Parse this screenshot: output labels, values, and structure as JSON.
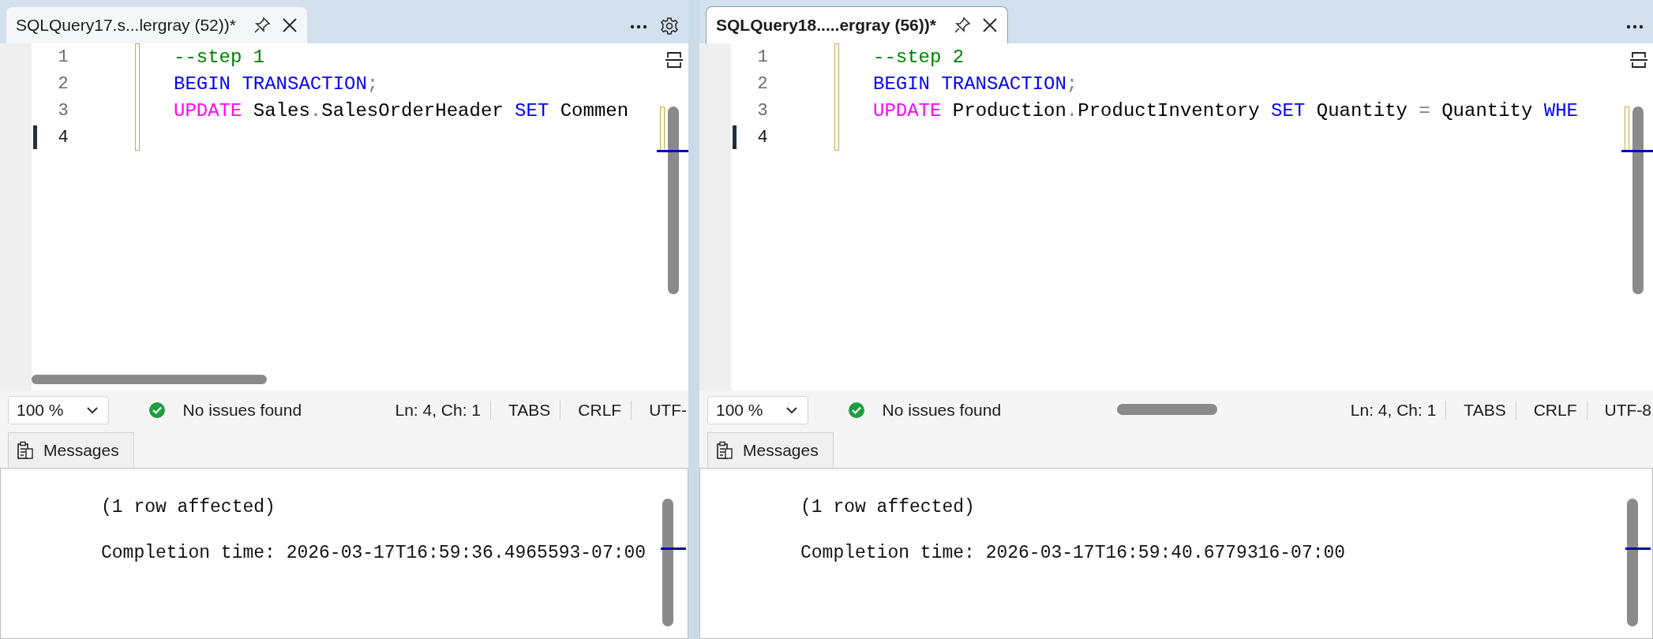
{
  "panes": [
    {
      "tab": {
        "title": "SQLQuery17.s...lergray (52))*",
        "selected": false
      },
      "has_settings": true,
      "lines": [
        {
          "number": "1",
          "current": false,
          "tokens": [
            {
              "text": "--step 1",
              "kind": "comment"
            }
          ]
        },
        {
          "number": "2",
          "current": false,
          "tokens": [
            {
              "text": "BEGIN TRANSACTION",
              "kind": "keyword"
            },
            {
              "text": ";",
              "kind": "punct"
            }
          ]
        },
        {
          "number": "3",
          "current": false,
          "tokens": [
            {
              "text": "UPDATE",
              "kind": "function"
            },
            {
              "text": " Sales",
              "kind": "plain"
            },
            {
              "text": ".",
              "kind": "punct"
            },
            {
              "text": "SalesOrderHeader ",
              "kind": "plain"
            },
            {
              "text": "SET",
              "kind": "keyword"
            },
            {
              "text": " Commen",
              "kind": "plain"
            }
          ]
        },
        {
          "number": "4",
          "current": true
        }
      ],
      "status": {
        "zoom": "100 %",
        "issues": "No issues found",
        "position": "Ln: 4, Ch: 1",
        "indent": "TABS",
        "line_ending": "CRLF",
        "encoding": "UTF-"
      },
      "messages_tab": "Messages",
      "messages": [
        "(1 row affected)",
        "Completion time: 2026-03-17T16:59:36.4965593-07:00"
      ]
    },
    {
      "tab": {
        "title": "SQLQuery18.....ergray (56))*",
        "selected": true
      },
      "has_settings": false,
      "lines": [
        {
          "number": "1",
          "current": false,
          "tokens": [
            {
              "text": "--step 2",
              "kind": "comment"
            }
          ]
        },
        {
          "number": "2",
          "current": false,
          "tokens": [
            {
              "text": "BEGIN TRANSACTION",
              "kind": "keyword"
            },
            {
              "text": ";",
              "kind": "punct"
            }
          ]
        },
        {
          "number": "3",
          "current": false,
          "tokens": [
            {
              "text": "UPDATE",
              "kind": "function"
            },
            {
              "text": " Production",
              "kind": "plain"
            },
            {
              "text": ".",
              "kind": "punct"
            },
            {
              "text": "ProductInventory ",
              "kind": "plain"
            },
            {
              "text": "SET",
              "kind": "keyword"
            },
            {
              "text": " Quantity ",
              "kind": "plain"
            },
            {
              "text": "=",
              "kind": "punct"
            },
            {
              "text": " Quantity ",
              "kind": "plain"
            },
            {
              "text": "WHE",
              "kind": "keyword"
            }
          ]
        },
        {
          "number": "4",
          "current": true
        }
      ],
      "status": {
        "zoom": "100 %",
        "issues": "No issues found",
        "position": "Ln: 4, Ch: 1",
        "indent": "TABS",
        "line_ending": "CRLF",
        "encoding": "UTF-8"
      },
      "messages_tab": "Messages",
      "messages": [
        "(1 row affected)",
        "Completion time: 2026-03-17T16:59:40.6779316-07:00"
      ]
    }
  ]
}
